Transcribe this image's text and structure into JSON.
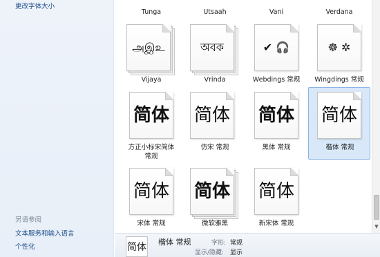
{
  "sidebar": {
    "change_font_size": "更改字体大小",
    "see_also": "另请参阅",
    "link_text_services": "文本服务和输入语言",
    "link_personalize": "个性化"
  },
  "fonts_top_row": [
    "Tunga",
    "Utsaah",
    "Vani",
    "Verdana"
  ],
  "fonts": [
    {
      "name": "Vijaya",
      "sample": "அஇஉ"
    },
    {
      "name": "Vrinda",
      "sample": "অবক"
    },
    {
      "name": "Webdings 常规",
      "sample": "✔ 🎧"
    },
    {
      "name": "Wingdings 常规",
      "sample": "☸ ✲"
    },
    {
      "name": "方正小标宋简体",
      "name2": "常规",
      "sample": "简体"
    },
    {
      "name": "仿宋 常规",
      "sample": "简体"
    },
    {
      "name": "黑体 常规",
      "sample": "简体"
    },
    {
      "name": "楷体 常规",
      "sample": "简体"
    },
    {
      "name": "宋体 常规",
      "sample": "简体"
    },
    {
      "name": "微软雅黑",
      "sample": "简体"
    },
    {
      "name": "新宋体 常规",
      "sample": "简体"
    }
  ],
  "details": {
    "thumb_sample": "简体",
    "name": "楷体 常规",
    "style_label": "字形:",
    "style_value": "常规",
    "visibility_label": "显示/隐藏:",
    "visibility_value": "显示"
  },
  "colors": {
    "link": "#1e4e8c",
    "selected_bg": "#d8e8f8",
    "selected_border": "#8cb4e3"
  }
}
